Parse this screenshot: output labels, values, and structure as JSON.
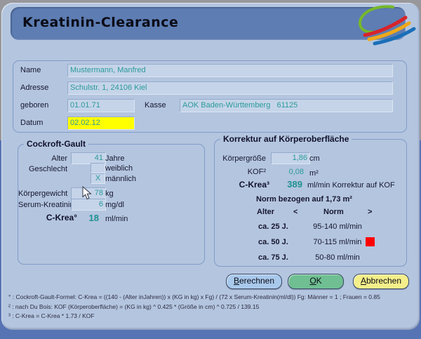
{
  "window": {
    "title": "Kreatinin-Clearance"
  },
  "patient": {
    "name_label": "Name",
    "name_value": "Mustermann, Manfred",
    "address_label": "Adresse",
    "address_value": "Schulstr. 1, 24106 Kiel",
    "born_label": "geboren",
    "born_value": "01.01.71",
    "insurer_label": "Kasse",
    "insurer_value": "AOK Baden-Württemberg   61125",
    "date_label": "Datum",
    "date_value": "02.02.12"
  },
  "cockroft": {
    "legend": "Cockroft-Gault",
    "alter_label": "Alter",
    "alter_value": "41",
    "alter_unit": "Jahre",
    "geschlecht_label": "Geschlecht",
    "weiblich_label": "weiblich",
    "weiblich_value": "",
    "maennlich_label": "männlich",
    "maennlich_value": "X",
    "gewicht_label": "Körpergewicht",
    "gewicht_value": "78",
    "gewicht_unit": "kg",
    "serum_label": "Serum-Kreatinin",
    "serum_value": "6",
    "serum_unit": "mg/dl",
    "ckrea_label": "C-Krea°",
    "ckrea_value": "18",
    "ckrea_unit": "ml/min"
  },
  "korrektur": {
    "legend": "Korrektur auf Körperoberfläche",
    "groesse_label": "Körpergröße",
    "groesse_value": "1,86",
    "groesse_unit": "cm",
    "kof_label": "KOF²",
    "kof_value": "0,08",
    "kof_unit": "m²",
    "ckrea_label": "C-Krea³",
    "ckrea_value": "389",
    "ckrea_unit": "ml/min Korrektur auf KOF",
    "norm_title": "Norm bezogen auf 1,73 m²",
    "table": {
      "col_alter": "Alter",
      "col_lt": "<",
      "col_norm": "Norm",
      "col_gt": ">",
      "rows": [
        {
          "alter": "ca. 25 J.",
          "norm": "95-140 ml/min",
          "marker": false
        },
        {
          "alter": "ca. 50 J.",
          "norm": "70-115 ml/min",
          "marker": true
        },
        {
          "alter": "ca. 75 J.",
          "norm": "50-80 ml/min",
          "marker": false
        }
      ]
    }
  },
  "buttons": {
    "berechnen": "Berechnen",
    "ok": "OK",
    "abbrechen": "Abbrechen"
  },
  "footnotes": [
    "° : Cockroft-Gault-Formel: C-Krea =  ((140 - (Alter inJahren)) x (KG in kg) x Fg) / (72 x Serum-Kreatinin(ml/dl)) Fg: Männer = 1 ; Frauen = 0.85",
    "² : nach Du Bois: KOF (Körperoberfläche) = (KG in kg) ^ 0.425 * (Größe in cm) ^ 0.725 / 139.15",
    "³ : C-Krea = C-Krea * 1.73 / KOF"
  ],
  "colors": {
    "window_bg": "#b4c5df",
    "titlebar_bg": "#5d7db3",
    "value_teal": "#2a9a9a",
    "date_field_bg": "#ffff00",
    "norm_marker": "#ff0000",
    "button_blue": "#a9c9ec",
    "button_green": "#6fbf92",
    "button_yellow": "#f4ef8a",
    "outer_bottom": "#5673b4",
    "outer_top": "#98989c"
  }
}
